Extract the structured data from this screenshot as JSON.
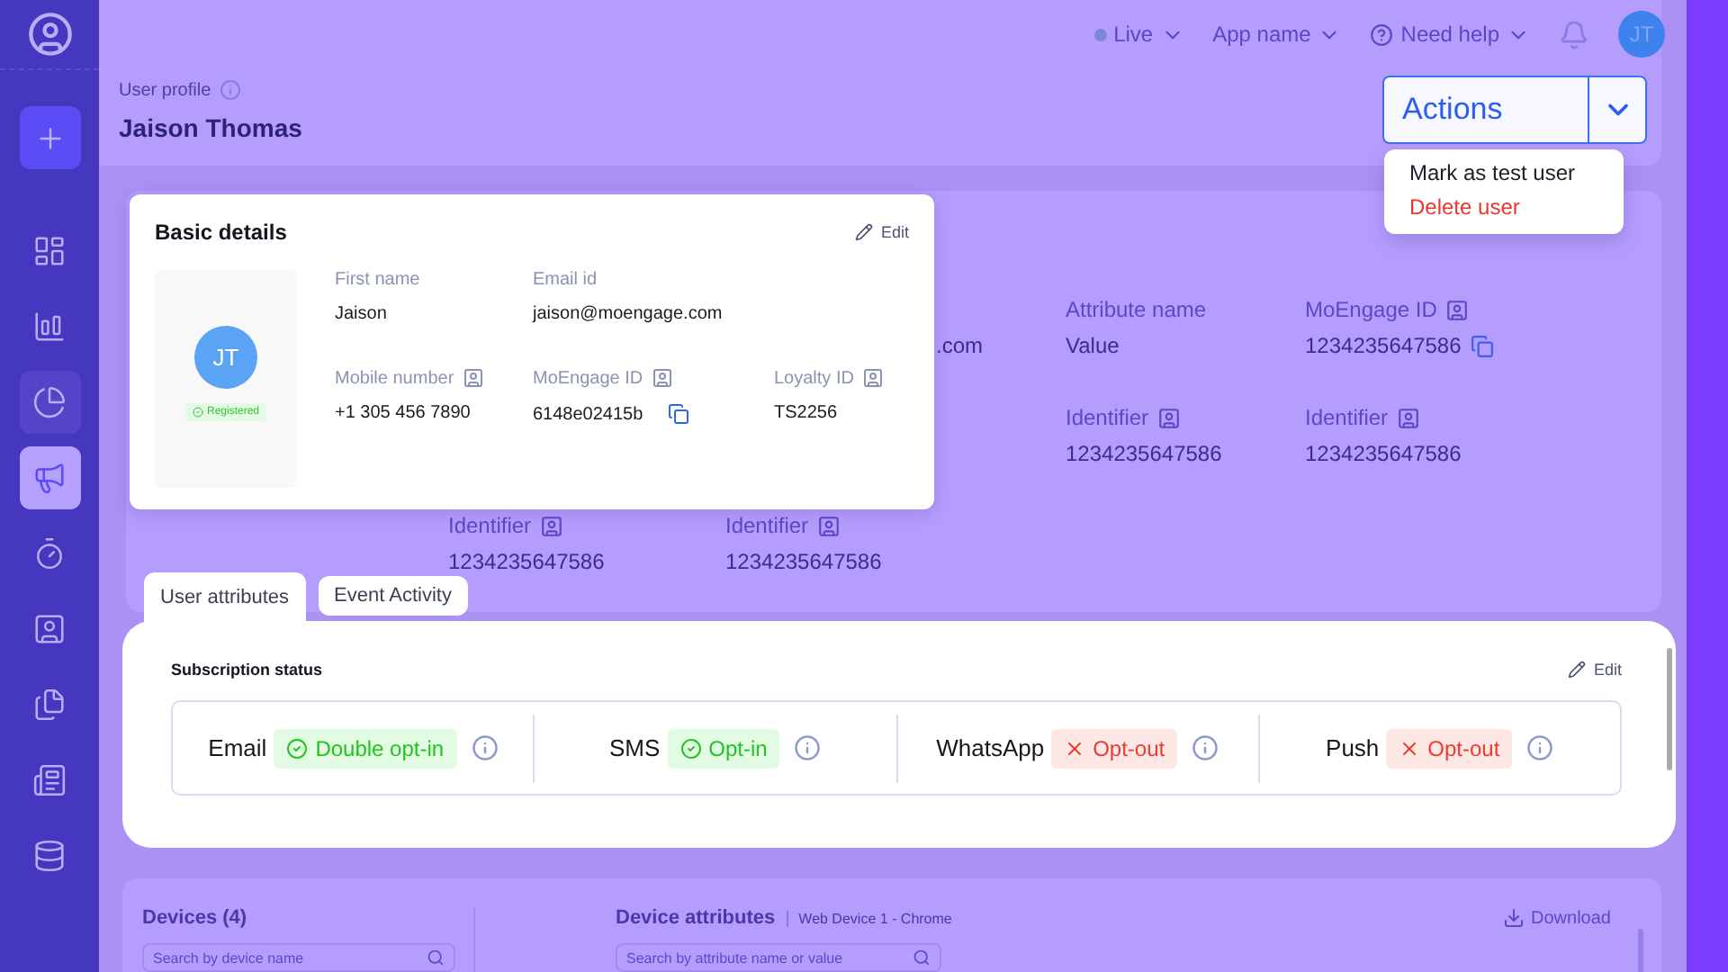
{
  "sidebar": {
    "items": [
      {
        "selected": false,
        "hovered": false
      },
      {
        "selected": false,
        "hovered": false
      },
      {
        "selected": false,
        "hovered": true
      },
      {
        "selected": true,
        "hovered": false
      },
      {
        "selected": false,
        "hovered": false
      },
      {
        "selected": false,
        "hovered": false
      },
      {
        "selected": false,
        "hovered": false
      },
      {
        "selected": false,
        "hovered": false
      },
      {
        "selected": false,
        "hovered": false
      }
    ]
  },
  "top_bar": {
    "environment": "Live",
    "app": "App name",
    "help": "Need help",
    "avatar": "JT"
  },
  "header": {
    "label": "User profile",
    "name": "Jaison Thomas",
    "actions": "Actions",
    "menu": [
      {
        "label": "Mark as test user",
        "kind": "normal"
      },
      {
        "label": "Delete user",
        "kind": "danger"
      }
    ]
  },
  "profile_background": {
    "fields": [
      {
        "value": ".com"
      },
      {
        "label": "Attribute name",
        "value": "Value",
        "id_icon": false,
        "copy": false
      },
      {
        "label": "MoEngage ID",
        "value": "1234235647586",
        "id_icon": true,
        "copy": true
      },
      {
        "label": "Identifier",
        "value": "1234235647586",
        "id_icon": true,
        "copy": false
      },
      {
        "label": "Identifier",
        "value": "1234235647586",
        "id_icon": true,
        "copy": false
      },
      {
        "label": "Identifier",
        "value": "1234235647586",
        "id_icon": true,
        "copy": false
      },
      {
        "label": "Identifier",
        "value": "1234235647586",
        "id_icon": true,
        "copy": false
      }
    ]
  },
  "basic_details": {
    "title": "Basic details",
    "edit": "Edit",
    "avatar": "JT",
    "status": "Registered",
    "fields": [
      {
        "label": "First name",
        "value": "Jaison",
        "id_icon": false,
        "copy": false
      },
      {
        "label": "Email id",
        "value": "jaison@moengage.com",
        "id_icon": false,
        "copy": false
      },
      {
        "label": "Mobile number",
        "value": "+1 305 456 7890",
        "id_icon": true,
        "copy": false
      },
      {
        "label": "MoEngage ID",
        "value": "6148e02415b",
        "id_icon": true,
        "copy": true
      },
      {
        "label": "Loyalty ID",
        "value": "TS2256",
        "id_icon": true,
        "copy": false
      }
    ]
  },
  "tabs": [
    {
      "label": "User attributes",
      "selected": true
    },
    {
      "label": "Event Activity",
      "selected": false
    }
  ],
  "subscription": {
    "title": "Subscription status",
    "edit": "Edit",
    "channels": [
      {
        "name": "Email",
        "status": "Double opt-in",
        "opted_in": true
      },
      {
        "name": "SMS",
        "status": "Opt-in",
        "opted_in": true
      },
      {
        "name": "WhatsApp",
        "status": "Opt-out",
        "opted_in": false
      },
      {
        "name": "Push",
        "status": "Opt-out",
        "opted_in": false
      }
    ]
  },
  "devices": {
    "title": "Devices (4)",
    "search_placeholder": "Search by device name",
    "attributes_title": "Device attributes",
    "device": "Web Device 1 - Chrome",
    "attributes_search_placeholder": "Search by attribute name or value",
    "download": "Download"
  }
}
